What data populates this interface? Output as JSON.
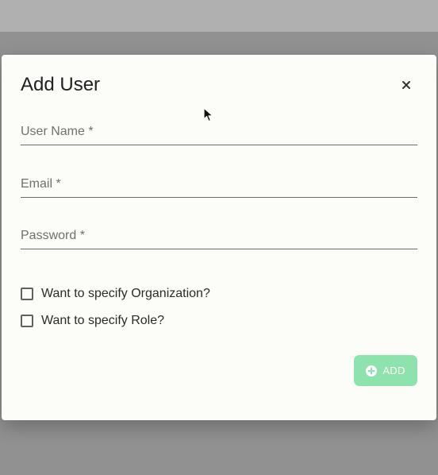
{
  "modal": {
    "title": "Add User",
    "close_icon": "close-icon",
    "fields": {
      "username": {
        "label": "User Name *",
        "value": ""
      },
      "email": {
        "label": "Email *",
        "value": ""
      },
      "password": {
        "label": "Password *",
        "value": ""
      }
    },
    "checkboxes": {
      "organization": {
        "label": "Want to specify Organization?",
        "checked": false
      },
      "role": {
        "label": "Want to specify Role?",
        "checked": false
      }
    },
    "add_button": {
      "label": "ADD",
      "icon": "plus-circle-icon",
      "color": "#8ee2ad"
    }
  }
}
